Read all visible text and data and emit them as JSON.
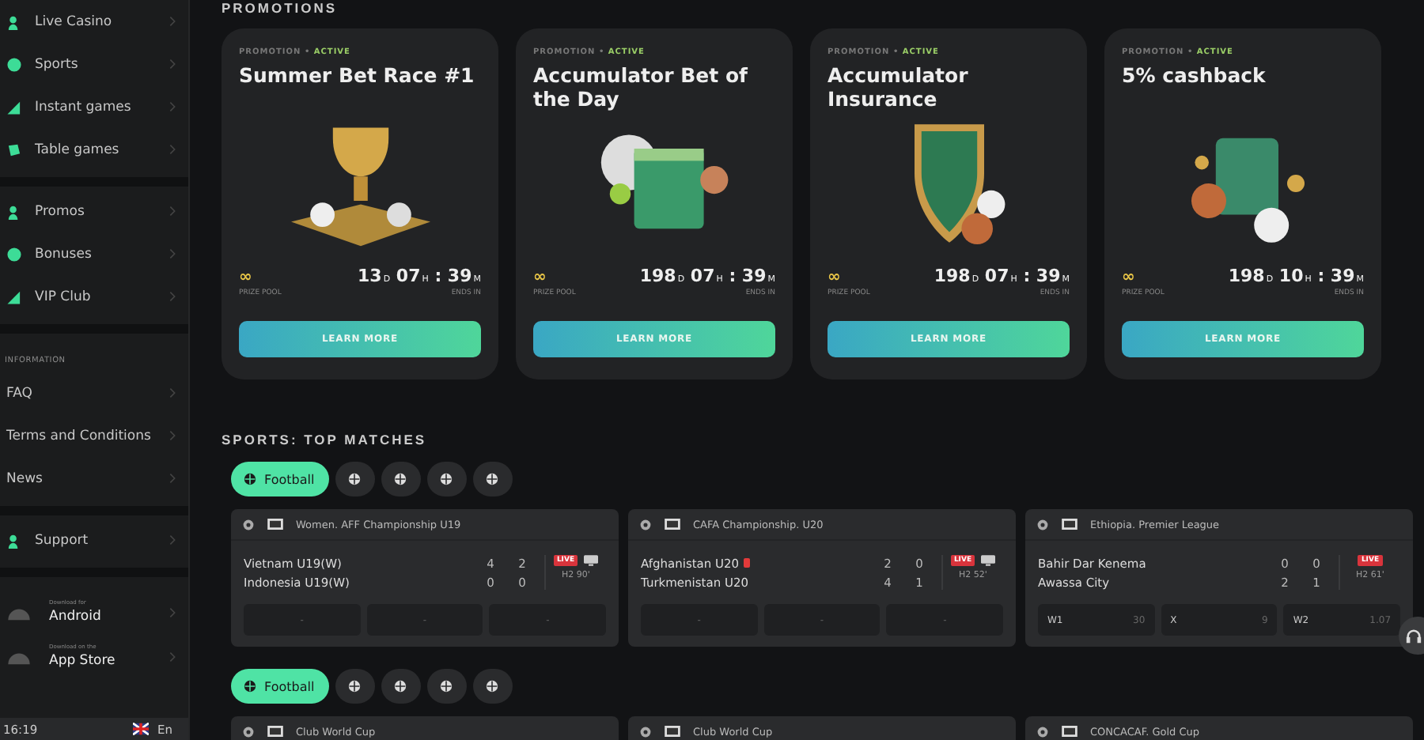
{
  "sidebar": {
    "groups": [
      {
        "items": [
          {
            "label": "Live Casino"
          },
          {
            "label": "Sports"
          },
          {
            "label": "Instant games"
          },
          {
            "label": "Table games"
          }
        ]
      },
      {
        "items": [
          {
            "label": "Promos"
          },
          {
            "label": "Bonuses"
          },
          {
            "label": "VIP Club"
          }
        ]
      },
      {
        "heading": "INFORMATION",
        "items": [
          {
            "label": "FAQ"
          },
          {
            "label": "Terms and Conditions"
          },
          {
            "label": "News"
          }
        ]
      },
      {
        "items": [
          {
            "label": "Support"
          }
        ]
      }
    ],
    "apps": [
      {
        "caption": "Download for",
        "name": "Android"
      },
      {
        "caption": "Download on the",
        "name": "App Store"
      }
    ],
    "footer": {
      "time": "16:19",
      "language": "En"
    }
  },
  "promotions": {
    "title": "PROMOTIONS",
    "cards": [
      {
        "tag": "PROMOTION",
        "dot": "•",
        "status": "ACTIVE",
        "title": "Summer Bet Race #1",
        "prize": "∞",
        "prize_label": "PRIZE POOL",
        "countdown": {
          "days": "13",
          "d": "D",
          "hours": "07",
          "h": "H",
          "sep": ":",
          "minutes": "39",
          "m": "M"
        },
        "ends_label": "ENDS IN",
        "button": "LEARN MORE"
      },
      {
        "tag": "PROMOTION",
        "dot": "•",
        "status": "ACTIVE",
        "title": "Accumulator Bet of the Day",
        "prize": "∞",
        "prize_label": "PRIZE POOL",
        "countdown": {
          "days": "198",
          "d": "D",
          "hours": "07",
          "h": "H",
          "sep": ":",
          "minutes": "39",
          "m": "M"
        },
        "ends_label": "ENDS IN",
        "button": "LEARN MORE"
      },
      {
        "tag": "PROMOTION",
        "dot": "•",
        "status": "ACTIVE",
        "title": "Accumulator Insurance",
        "prize": "∞",
        "prize_label": "PRIZE POOL",
        "countdown": {
          "days": "198",
          "d": "D",
          "hours": "07",
          "h": "H",
          "sep": ":",
          "minutes": "39",
          "m": "M"
        },
        "ends_label": "ENDS IN",
        "button": "LEARN MORE"
      },
      {
        "tag": "PROMOTION",
        "dot": "•",
        "status": "ACTIVE",
        "title": "5% cashback",
        "prize": "∞",
        "prize_label": "PRIZE POOL",
        "countdown": {
          "days": "198",
          "d": "D",
          "hours": "10",
          "h": "H",
          "sep": ":",
          "minutes": "39",
          "m": "M"
        },
        "ends_label": "ENDS IN",
        "button": "LEARN MORE"
      }
    ]
  },
  "top_matches": {
    "title": "SPORTS: TOP MATCHES",
    "sections": [
      {
        "chips": [
          {
            "label": "Football",
            "selected": true
          },
          {
            "selected": false
          },
          {
            "selected": false
          },
          {
            "selected": false
          },
          {
            "selected": false
          }
        ],
        "matches": [
          {
            "league": "Women. AFF Championship U19",
            "teams": [
              {
                "name": "Vietnam U19(W)",
                "red_card": false,
                "scores": [
                  "4",
                  "2"
                ]
              },
              {
                "name": "Indonesia U19(W)",
                "red_card": false,
                "scores": [
                  "0",
                  "0"
                ]
              }
            ],
            "live": "LIVE",
            "stream": true,
            "time": "H2 90'",
            "odds": [
              {
                "value": "-"
              },
              {
                "value": "-"
              },
              {
                "value": "-"
              }
            ]
          },
          {
            "league": "CAFA Championship. U20",
            "teams": [
              {
                "name": "Afghanistan U20",
                "red_card": true,
                "scores": [
                  "2",
                  "0"
                ]
              },
              {
                "name": "Turkmenistan U20",
                "red_card": false,
                "scores": [
                  "4",
                  "1"
                ]
              }
            ],
            "live": "LIVE",
            "stream": true,
            "time": "H2 52'",
            "odds": [
              {
                "value": "-"
              },
              {
                "value": "-"
              },
              {
                "value": "-"
              }
            ]
          },
          {
            "league": "Ethiopia. Premier League",
            "teams": [
              {
                "name": "Bahir Dar Kenema",
                "red_card": false,
                "scores": [
                  "0",
                  "0"
                ]
              },
              {
                "name": "Awassa City",
                "red_card": false,
                "scores": [
                  "2",
                  "1"
                ]
              }
            ],
            "live": "LIVE",
            "stream": false,
            "time": "H2 61'",
            "odds": [
              {
                "label": "W1",
                "value": "30"
              },
              {
                "label": "X",
                "value": "9"
              },
              {
                "label": "W2",
                "value": "1.07"
              }
            ]
          }
        ]
      },
      {
        "chips": [
          {
            "label": "Football",
            "selected": true
          },
          {
            "selected": false
          },
          {
            "selected": false
          },
          {
            "selected": false
          },
          {
            "selected": false
          }
        ],
        "matches": [
          {
            "league": "Club World Cup"
          },
          {
            "league": "Club World Cup"
          },
          {
            "league": "CONCACAF. Gold Cup"
          }
        ]
      }
    ]
  }
}
